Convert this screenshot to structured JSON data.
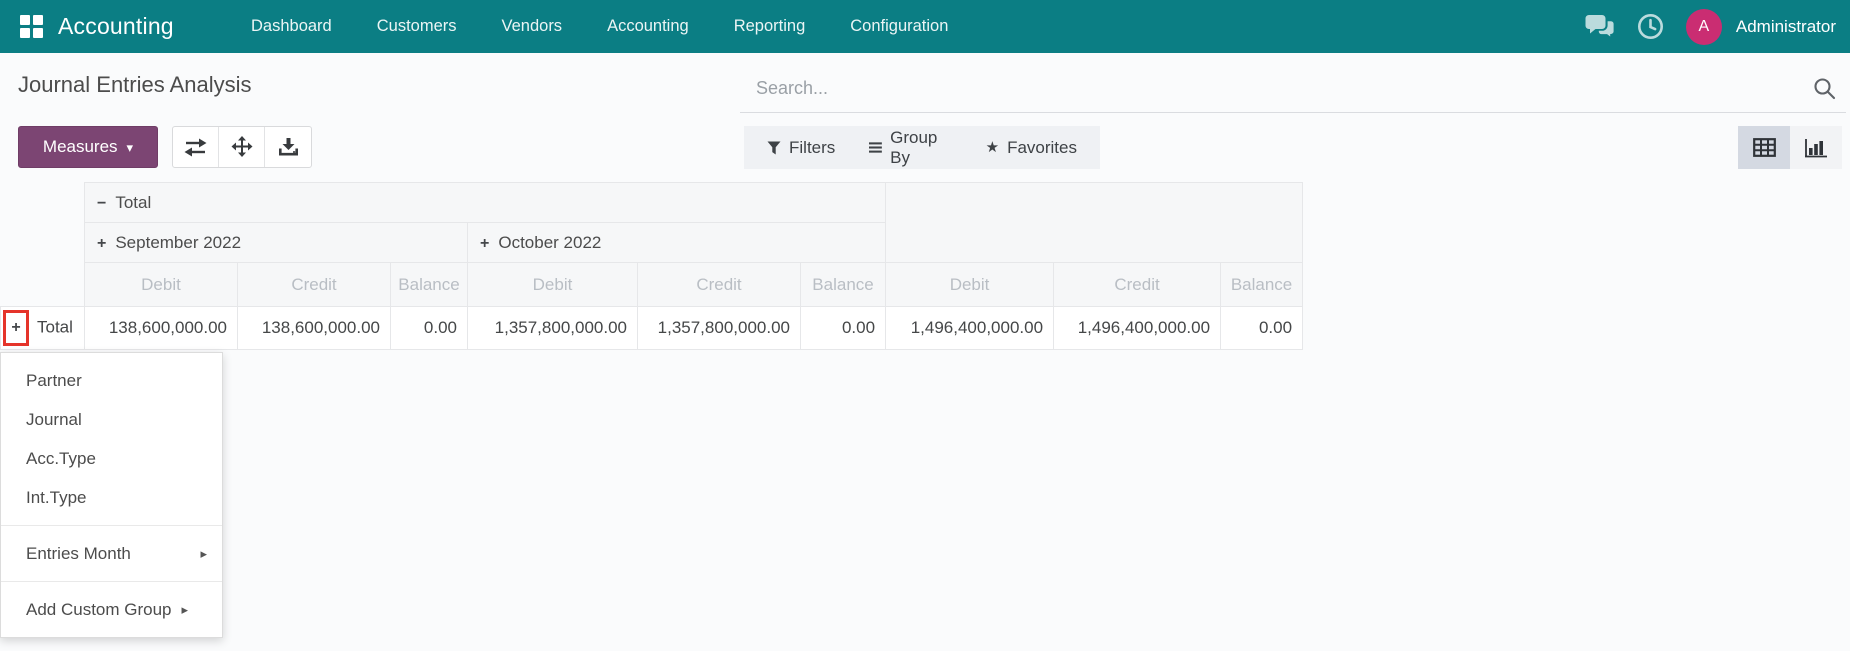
{
  "colors": {
    "navbar_bg": "#0b7e84",
    "primary_button": "#7c4573",
    "avatar_bg": "#ca2d72",
    "highlight_box": "#e5342a",
    "header_cell_bg": "#f6f7f8"
  },
  "icons": {
    "plus": "+",
    "minus": "−",
    "caret_down": "▾",
    "star": "★",
    "submenu_arrow": "▸"
  },
  "navbar": {
    "brand": "Accounting",
    "items": [
      "Dashboard",
      "Customers",
      "Vendors",
      "Accounting",
      "Reporting",
      "Configuration"
    ],
    "user": {
      "initial": "A",
      "name": "Administrator"
    }
  },
  "control_panel": {
    "title": "Journal Entries Analysis",
    "search_placeholder": "Search...",
    "measures_label": "Measures",
    "filter_menus": [
      "Filters",
      "Group By",
      "Favorites"
    ]
  },
  "pivot": {
    "top_group": "Total",
    "months": [
      "September 2022",
      "October 2022"
    ],
    "measures": [
      "Debit",
      "Credit",
      "Balance"
    ],
    "row_label": "Total",
    "values": {
      "september": {
        "debit": "138,600,000.00",
        "credit": "138,600,000.00",
        "balance": "0.00"
      },
      "october": {
        "debit": "1,357,800,000.00",
        "credit": "1,357,800,000.00",
        "balance": "0.00"
      },
      "total": {
        "debit": "1,496,400,000.00",
        "credit": "1,496,400,000.00",
        "balance": "0.00"
      }
    }
  },
  "groupby_menu": {
    "items": [
      "Partner",
      "Journal",
      "Acc.Type",
      "Int.Type"
    ],
    "submenu_items": [
      "Entries Month",
      "Add Custom Group"
    ]
  }
}
